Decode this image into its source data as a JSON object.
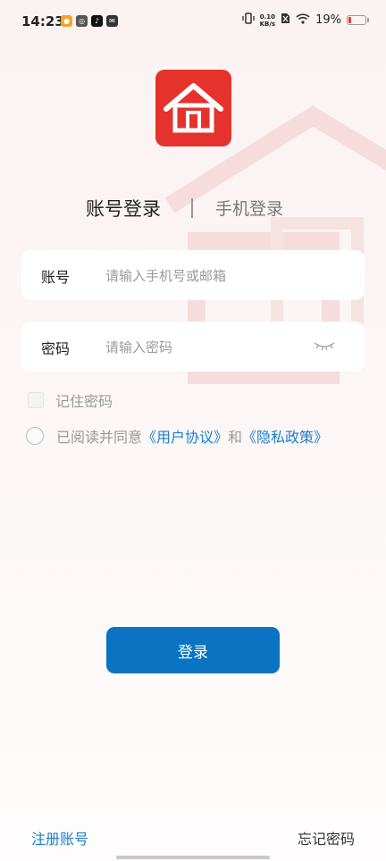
{
  "status_bar": {
    "time": "14:23",
    "app_icons": [
      "weibo-icon",
      "qq-browser-icon",
      "tiktok-icon",
      "message-icon"
    ],
    "net_speed_value": "0.10",
    "net_speed_unit": "KB/s",
    "battery_percent": "19%",
    "battery_level": 0.19,
    "battery_color": "#e53935"
  },
  "logo": {
    "icon": "house-icon",
    "color": "#e5322d"
  },
  "tabs": {
    "account_login": "账号登录",
    "phone_login": "手机登录"
  },
  "form": {
    "account_label": "账号",
    "account_placeholder": "请输入手机号或邮箱",
    "password_label": "密码",
    "password_placeholder": "请输入密码",
    "password_visibility_icon": "eye-closed-icon",
    "remember_label": "记住密码",
    "agree_prefix": "已阅读并同意",
    "user_agreement": "《用户协议》",
    "agree_and": "和",
    "privacy_policy": "《隐私政策》"
  },
  "login_button": "登录",
  "footer": {
    "register": "注册账号",
    "forgot_password": "忘记密码"
  },
  "colors": {
    "accent_blue": "#0a74c2",
    "link_blue": "#1a7fcc",
    "brand_red": "#e5322d"
  }
}
